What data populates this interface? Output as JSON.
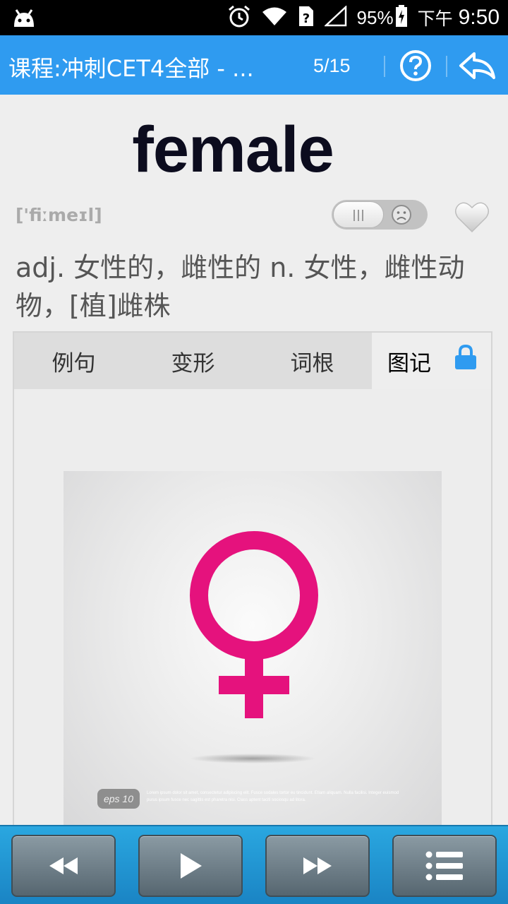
{
  "status_bar": {
    "battery": "95%",
    "ampm": "下午",
    "time": "9:50",
    "icons": [
      "android-icon",
      "alarm-icon",
      "wifi-icon",
      "sim-unknown-icon",
      "signal-icon",
      "battery-charging-icon"
    ]
  },
  "app_bar": {
    "title": "课程:冲刺CET4全部 - ...",
    "progress": "5/15",
    "help_icon": "help-circle-icon",
    "back_icon": "reply-back-icon",
    "color": "#2f9bf0"
  },
  "word": {
    "text": "female",
    "phonetic": "['fiːmeɪl]",
    "definition": "adj. 女性的，雌性的 n. 女性，雌性动物，[植]雌株",
    "familiarity_toggle_icon": "sad-face-icon",
    "favorite_icon": "heart-icon"
  },
  "tabs": [
    {
      "label": "例句",
      "active": false
    },
    {
      "label": "变形",
      "active": false
    },
    {
      "label": "词根",
      "active": false
    },
    {
      "label": "图记",
      "active": true,
      "locked": true
    }
  ],
  "image": {
    "subject": "female-symbol-icon",
    "symbol_color": "#e5127d",
    "badge": "eps 10",
    "caption": "Lorem ipsum dolor sit amet, consectetur adipiscing elit. Fusce sodales tortor eu tincidunt. Etiam aliquam. Nulla facilisi. Integer euismod purus ipsum fusce nec sagittis est pharetra nisi. Class aptent taciti sociosqu ad litora."
  },
  "controls": [
    {
      "name": "rewind",
      "icon": "rewind-icon"
    },
    {
      "name": "play",
      "icon": "play-icon"
    },
    {
      "name": "fast-forward",
      "icon": "fast-forward-icon"
    },
    {
      "name": "list",
      "icon": "list-icon"
    }
  ]
}
